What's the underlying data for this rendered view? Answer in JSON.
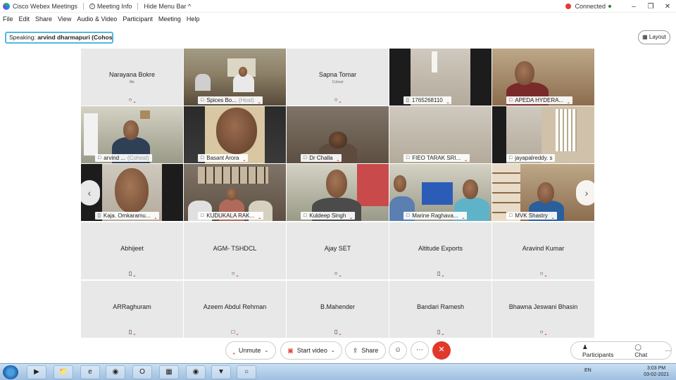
{
  "titlebar": {
    "app_title": "Cisco Webex Meetings",
    "meeting_info": "Meeting Info",
    "hide_menu": "Hide Menu Bar ^",
    "connected": "Connected"
  },
  "menu": [
    "File",
    "Edit",
    "Share",
    "View",
    "Audio & Video",
    "Participant",
    "Meeting",
    "Help"
  ],
  "speaking": {
    "prefix": "Speaking:",
    "name": "arvind dharmapuri  (Cohost)"
  },
  "layout_label": "Layout",
  "participants": [
    {
      "name": "Narayana Bokre",
      "sub": "Me",
      "video": false
    },
    {
      "name": "Spices Bo...",
      "host": "(Host)",
      "video": true
    },
    {
      "name": "Sapna Tomar",
      "sub": "Cohost",
      "video": false
    },
    {
      "name": "1765268110",
      "video": true
    },
    {
      "name": "APEDA HYDERA...",
      "video": true
    },
    {
      "name": "arvind ...",
      "host": "(Cohost)",
      "video": true
    },
    {
      "name": "Basant Arora",
      "video": true
    },
    {
      "name": "Dr Challa",
      "video": true
    },
    {
      "name": "FIEO TARAK SRI...",
      "video": true
    },
    {
      "name": "jayapalreddy. s",
      "video": true
    },
    {
      "name": "Kaja. Omkaramu...",
      "video": true
    },
    {
      "name": "KUDUKALA RAK...",
      "video": true
    },
    {
      "name": "Kuldeep Singh",
      "video": true
    },
    {
      "name": "Marine Raghava...",
      "video": true
    },
    {
      "name": "MVK Shastry",
      "video": true
    },
    {
      "name": "Abhijeet",
      "video": false
    },
    {
      "name": "AGM- TSHDCL",
      "video": false
    },
    {
      "name": "Ajay SET",
      "video": false
    },
    {
      "name": "Altitude Exports",
      "video": false
    },
    {
      "name": "Aravind Kumar",
      "video": false
    },
    {
      "name": "ARRaghuram",
      "video": false
    },
    {
      "name": "Azeem Abdul Rehman",
      "video": false
    },
    {
      "name": "B.Mahender",
      "video": false
    },
    {
      "name": "Bandari Ramesh",
      "video": false
    },
    {
      "name": "Bhawna Jeswani Bhasin",
      "video": false
    }
  ],
  "controls": {
    "unmute": "Unmute",
    "start_video": "Start video",
    "share": "Share",
    "participants": "Participants",
    "chat": "Chat"
  },
  "taskbar": {
    "lang": "EN",
    "time": "3:03 PM",
    "date": "03-02-2021"
  },
  "colors": {
    "end_call": "#e0392b",
    "speaker_outline": "#3fb8e6",
    "mic_muted": "#d9453a"
  }
}
